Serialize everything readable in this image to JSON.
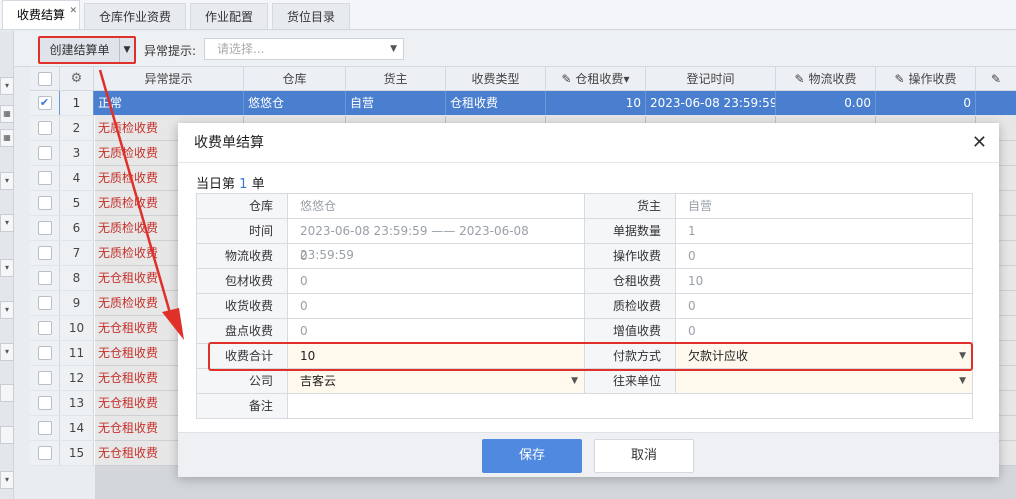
{
  "tabs": [
    {
      "label": "收费结算",
      "active": true
    },
    {
      "label": "仓库作业资费",
      "active": false
    },
    {
      "label": "作业配置",
      "active": false
    },
    {
      "label": "货位目录",
      "active": false
    }
  ],
  "toolbar": {
    "create_label": "创建结算单",
    "filter_label": "异常提示:",
    "filter_placeholder": "请选择..."
  },
  "grid": {
    "columns": [
      "异常提示",
      "仓库",
      "货主",
      "收费类型",
      "仓租收费",
      "登记时间",
      "物流收费",
      "操作收费"
    ],
    "selected_row": {
      "index": "1",
      "warning": "正常",
      "warehouse": "悠悠仓",
      "owner": "自营",
      "fee_type": "仓租收费",
      "rent": "10",
      "time": "2023-06-08 23:59:59",
      "logistics": "0.00",
      "operation": "0"
    },
    "rows": [
      {
        "index": "2",
        "warning": "无质检收费"
      },
      {
        "index": "3",
        "warning": "无质检收费"
      },
      {
        "index": "4",
        "warning": "无质检收费"
      },
      {
        "index": "5",
        "warning": "无质检收费"
      },
      {
        "index": "6",
        "warning": "无质检收费"
      },
      {
        "index": "7",
        "warning": "无质检收费"
      },
      {
        "index": "8",
        "warning": "无仓租收费"
      },
      {
        "index": "9",
        "warning": "无质检收费"
      },
      {
        "index": "10",
        "warning": "无仓租收费"
      },
      {
        "index": "11",
        "warning": "无仓租收费"
      },
      {
        "index": "12",
        "warning": "无仓租收费"
      },
      {
        "index": "13",
        "warning": "无仓租收费"
      },
      {
        "index": "14",
        "warning": "无仓租收费"
      },
      {
        "index": "15",
        "warning": "无仓租收费"
      }
    ]
  },
  "modal": {
    "title": "收费单结算",
    "sub_prefix": "当日第",
    "sub_count": "1",
    "sub_suffix": "单",
    "fields": {
      "warehouse_label": "仓库",
      "warehouse": "悠悠仓",
      "owner_label": "货主",
      "owner": "自营",
      "time_label": "时间",
      "time": "2023-06-08 23:59:59 —— 2023-06-08 23:59:59",
      "doc_count_label": "单据数量",
      "doc_count": "1",
      "logistics_label": "物流收费",
      "logistics": "0",
      "operation_label": "操作收费",
      "operation": "0",
      "packing_label": "包材收费",
      "packing": "0",
      "rent_label": "仓租收费",
      "rent": "10",
      "receiving_label": "收货收费",
      "receiving": "0",
      "qc_label": "质检收费",
      "qc": "0",
      "inventory_label": "盘点收费",
      "inventory": "0",
      "value_added_label": "增值收费",
      "value_added": "0",
      "total_label": "收费合计",
      "total": "10",
      "payment_label": "付款方式",
      "payment": "欠款计应收",
      "company_label": "公司",
      "company": "吉客云",
      "partner_label": "往来单位",
      "partner": "",
      "remark_label": "备注",
      "remark": ""
    },
    "save_label": "保存",
    "cancel_label": "取消"
  },
  "colors": {
    "accent": "#4f8ae0",
    "selected_row": "#4a7fd0",
    "warning_text": "#d9302a",
    "annotation": "#e0302a"
  }
}
